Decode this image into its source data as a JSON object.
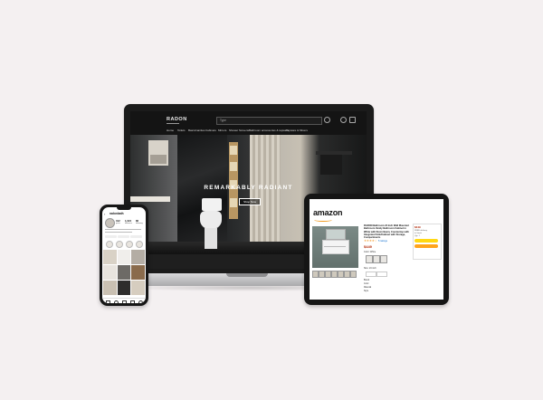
{
  "website": {
    "logo": "RADON",
    "search_placeholder": "Type",
    "nav": [
      "Home",
      "Toilets",
      "Basin/vanities",
      "Cabinets",
      "Mirrors",
      "Shower Screens",
      "Bathroom accessories & tapware",
      "Tapware & Mixers"
    ],
    "hero_title": "REMARKABLY RADIANT",
    "hero_button": "Shop Now"
  },
  "amazon": {
    "logo": "amazon",
    "product_title": "RADON Bathroom 24 Inch Wall Mounted Bathroom Vanity Bathroom Cabinet in White with Resin Basin, Countertop with Integrated Sink/Cabinet with Storage, Compartments",
    "stars": "★★★★☆",
    "rating_count": "5 ratings",
    "price": "$449",
    "color_label": "Color: White",
    "size_label": "Size: 24 inch",
    "specs": [
      "Brand",
      "Color",
      "Material",
      "Style"
    ],
    "buy_price": "$449",
    "buy_lines": [
      "FREE delivery",
      "In Stock",
      "Qty: 1"
    ],
    "add_to_cart": "Add to Cart",
    "buy_now": "Buy Now"
  },
  "instagram": {
    "username": "radonbath",
    "stats": [
      {
        "value": "312",
        "label": "posts"
      },
      {
        "value": "1,024",
        "label": "followers"
      },
      {
        "value": "86",
        "label": "following"
      }
    ]
  },
  "colors": {
    "background": "#f4f0f1",
    "amazon_orange": "#f29a1d",
    "amazon_price": "#b12704"
  }
}
